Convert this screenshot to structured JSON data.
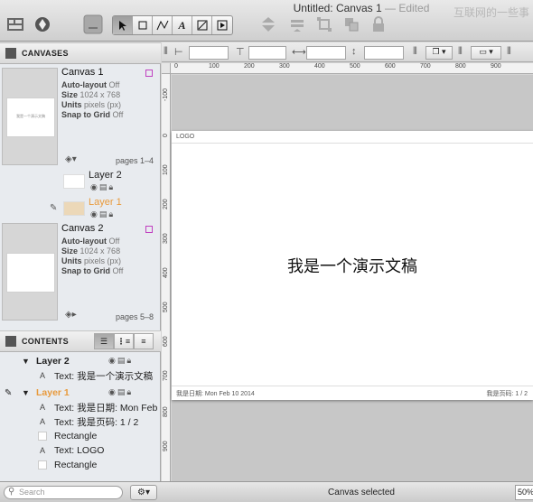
{
  "window": {
    "title": "Untitled: Canvas 1",
    "edited": " — Edited",
    "watermark": "互联网的一些事"
  },
  "toolbar": {
    "tools": [
      "select-tool",
      "rect-tool",
      "line-tool",
      "text-tool",
      "diagram-tool",
      "present-tool"
    ]
  },
  "canvases_section": {
    "title": "CANVASES"
  },
  "canvases": [
    {
      "name": "Canvas 1",
      "thumb_text": "我是一个演示文稿",
      "props": [
        {
          "label": "Auto-layout",
          "value": "Off"
        },
        {
          "label": "Size",
          "value": "1024 x 768"
        },
        {
          "label": "Units",
          "value": "pixels (px)"
        },
        {
          "label": "Snap to Grid",
          "value": "Off"
        }
      ],
      "pages": "pages 1–4"
    },
    {
      "name": "Canvas 2",
      "props": [
        {
          "label": "Auto-layout",
          "value": "Off"
        },
        {
          "label": "Size",
          "value": "1024 x 768"
        },
        {
          "label": "Units",
          "value": "pixels (px)"
        },
        {
          "label": "Snap to Grid",
          "value": "Off"
        }
      ],
      "pages": "pages 5–8"
    }
  ],
  "layers": [
    {
      "name": "Layer 2",
      "color": "#111111"
    },
    {
      "name": "Layer 1",
      "color": "#e89a3c"
    }
  ],
  "contents_section": {
    "title": "CONTENTS"
  },
  "contents": {
    "layer2": {
      "name": "Layer 2",
      "items": [
        "Text: 我是一个演示文稿"
      ]
    },
    "layer1": {
      "name": "Layer 1",
      "items": [
        "Text: 我是日期:  Mon Feb",
        "Text: 我是页码:  1 / 2",
        "Rectangle",
        "Text: LOGO",
        "Rectangle"
      ]
    }
  },
  "ruler": {
    "top": [
      "0",
      "100",
      "200",
      "300",
      "400",
      "500",
      "600",
      "700",
      "800",
      "900"
    ],
    "left": [
      "-100",
      "0",
      "100",
      "200",
      "300",
      "400",
      "500",
      "600",
      "700",
      "800",
      "900"
    ]
  },
  "page": {
    "logo": "LOGO",
    "title": "我是一个演示文稿",
    "date": "我是日期:  Mon Feb 10 2014",
    "page_num": "我是页码:  1 / 2"
  },
  "bottom": {
    "search_placeholder": "Search",
    "status": "Canvas selected",
    "zoom": "50%"
  }
}
